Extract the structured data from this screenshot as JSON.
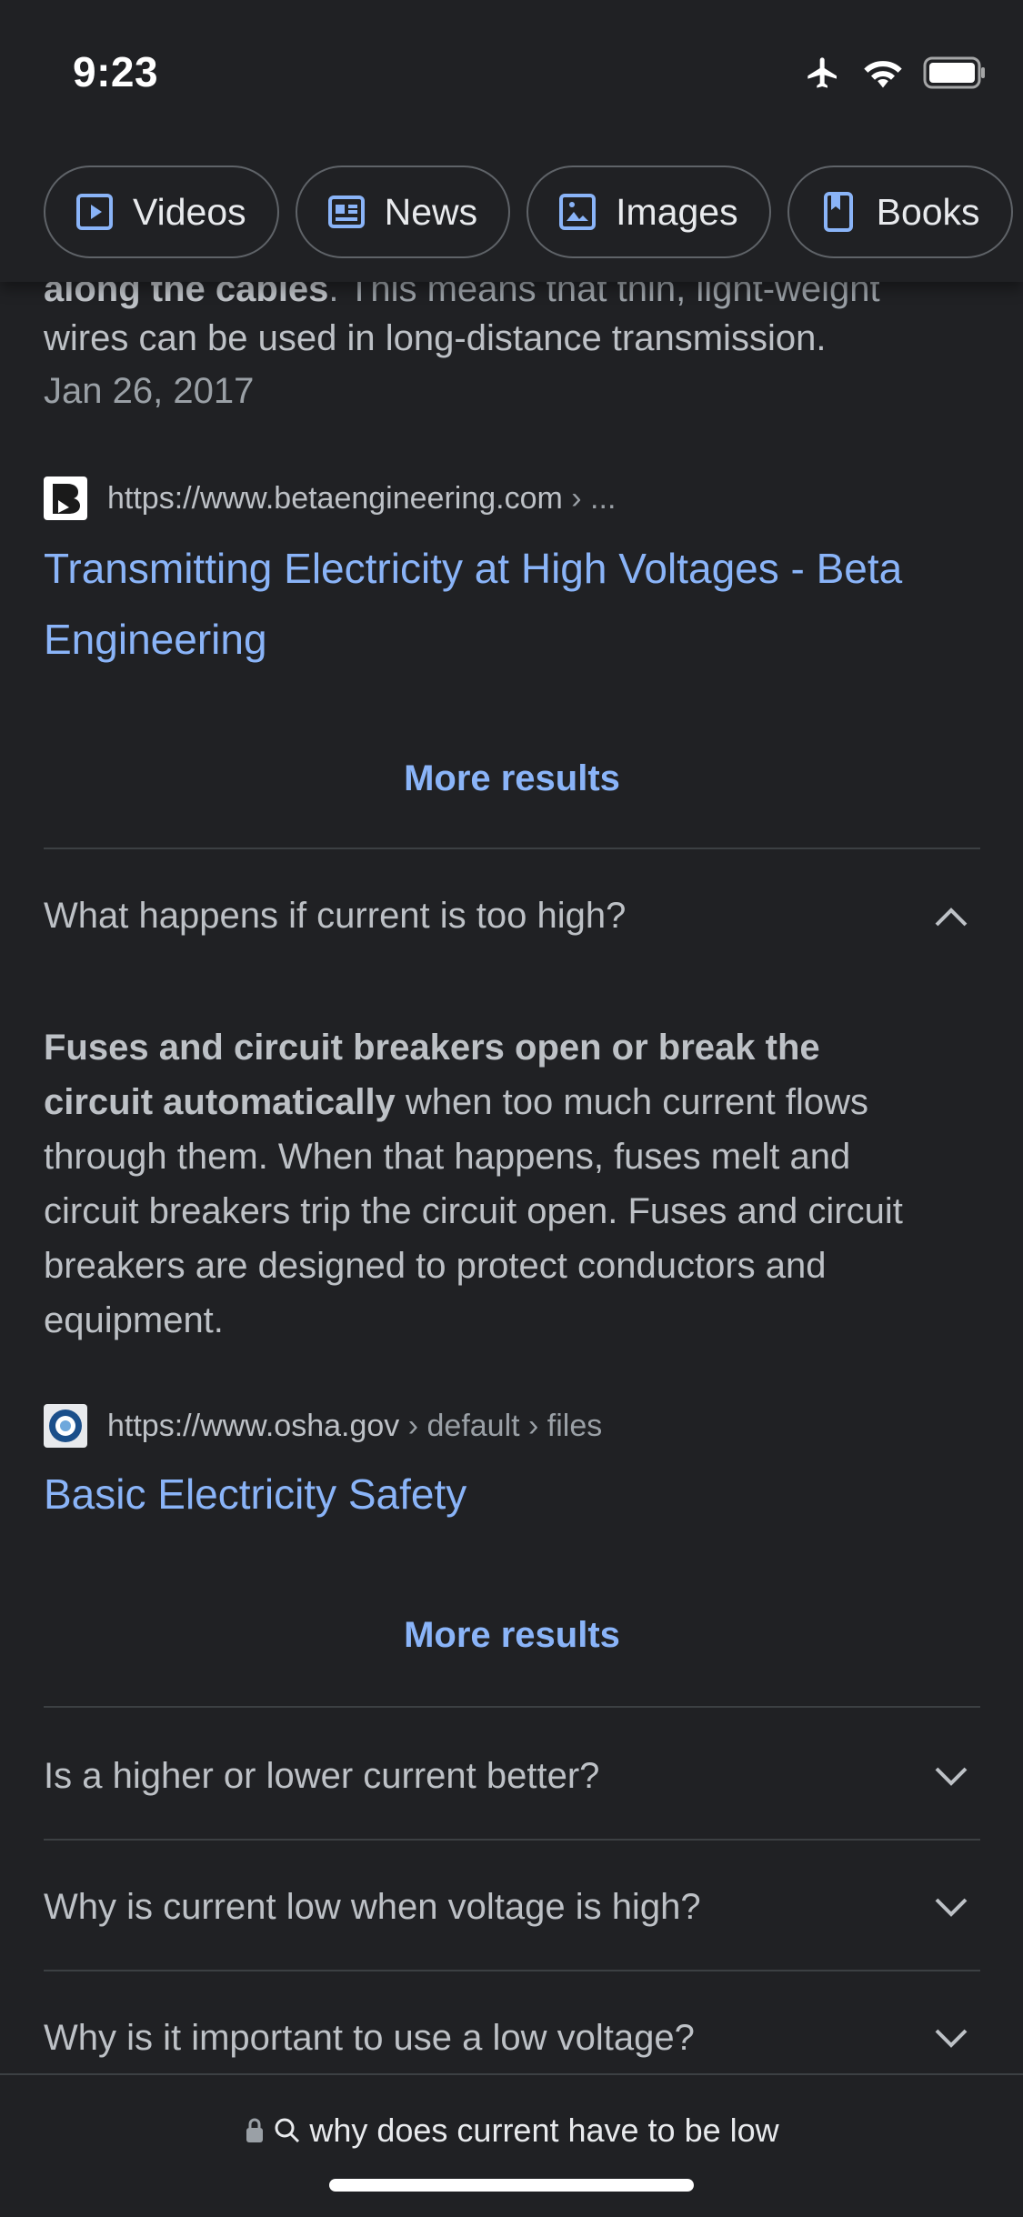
{
  "status": {
    "time": "9:23"
  },
  "chips": [
    {
      "label": "Videos",
      "icon": "video-icon"
    },
    {
      "label": "News",
      "icon": "news-icon"
    },
    {
      "label": "Images",
      "icon": "image-icon"
    },
    {
      "label": "Books",
      "icon": "book-icon"
    }
  ],
  "prev_result": {
    "snippet_bold": "along the cables",
    "snippet_rest": ". This means that thin, light-weight",
    "snippet_line2": "wires can be used in long-distance transmission.",
    "date": "Jan 26, 2017",
    "source_url": "https://www.betaengineering.com",
    "source_path": " › ...",
    "title_line1": "Transmitting Electricity at High Voltages - Beta",
    "title_line2": "Engineering",
    "more": "More results"
  },
  "expanded": {
    "question": "What happens if current is too high?",
    "answer_bold_1": "Fuses and circuit breakers open or break the",
    "answer_bold_2": "circuit automatically",
    "answer_rest_1": " when too much current flows",
    "answer_line3": "through them. When that happens, fuses melt and",
    "answer_line4": "circuit breakers trip the circuit open. Fuses and circuit",
    "answer_line5": "breakers are designed to protect conductors and",
    "answer_line6": "equipment.",
    "source_url": "https://www.osha.gov",
    "source_path": " › default › files",
    "title": "Basic Electricity Safety",
    "more": "More results"
  },
  "questions": [
    "Is a higher or lower current better?",
    "Why is current low when voltage is high?",
    "Why is it important to use a low voltage?"
  ],
  "address_bar": {
    "query": "why does current have to be low"
  }
}
